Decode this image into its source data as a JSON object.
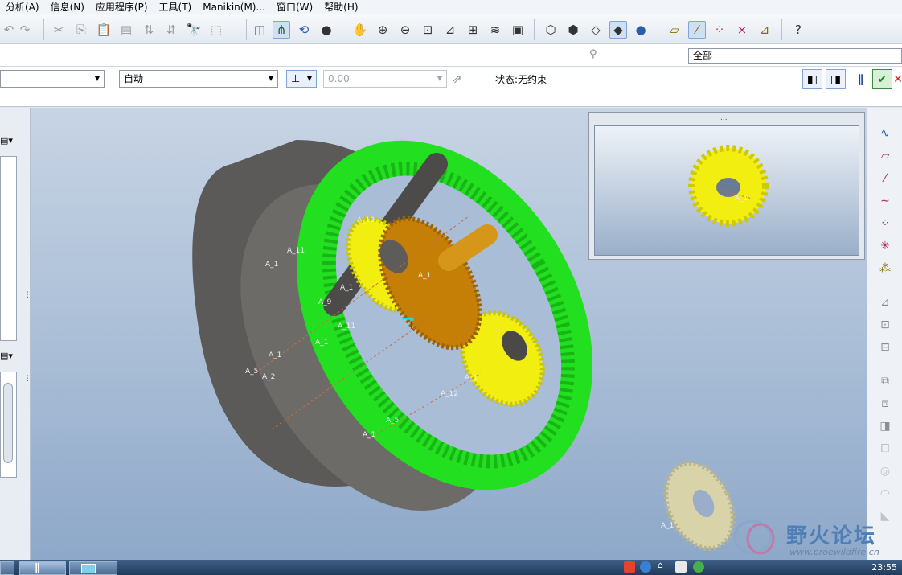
{
  "menu": {
    "items": [
      "分析(A)",
      "信息(N)",
      "应用程序(P)",
      "工具(T)",
      "Manikin(M)...",
      "窗口(W)",
      "帮助(H)"
    ]
  },
  "icons": {
    "undo": "↶",
    "redo": "↷",
    "cut": "✂",
    "copy": "⎘",
    "paste": "📋",
    "binoculars": "🔭",
    "select_box": "⬚",
    "datum_display": "⌂",
    "pan": "✋",
    "zoom_in": "⊕",
    "zoom_out": "⊖",
    "refit": "⊡",
    "spin": "⟲",
    "shade": "●",
    "help": "?"
  },
  "row2": {
    "filter_value": "全部"
  },
  "dashboard": {
    "ref_combo_value": "",
    "mode_combo_value": "自动",
    "value_field": "0.00",
    "status_label": "状态:无约束"
  },
  "viewport": {
    "axis_labels": [
      {
        "id": "a1",
        "text": "A_10"
      },
      {
        "id": "a2",
        "text": "A_1"
      },
      {
        "id": "a3",
        "text": "A_11"
      },
      {
        "id": "a4",
        "text": "A_1"
      },
      {
        "id": "a5",
        "text": "A_9"
      },
      {
        "id": "a6",
        "text": "A_1"
      },
      {
        "id": "a7",
        "text": "A_11"
      },
      {
        "id": "a8",
        "text": "A_1"
      },
      {
        "id": "a9",
        "text": "A_1"
      },
      {
        "id": "a10",
        "text": "A_5"
      },
      {
        "id": "a11",
        "text": "A_2"
      },
      {
        "id": "a12",
        "text": "A_1"
      },
      {
        "id": "a13",
        "text": "A_12"
      },
      {
        "id": "a14",
        "text": "A_5"
      },
      {
        "id": "a15",
        "text": "A_1"
      },
      {
        "id": "a16",
        "text": "A_1"
      }
    ],
    "preview_label": "A_1"
  },
  "watermark": {
    "title": "野火论坛",
    "url": "www.proewildfire.cn"
  },
  "taskbar": {
    "clock": "23:55"
  },
  "colors": {
    "ring_gear": "#22e01f",
    "planet_gear": "#f2ee10",
    "sun_gear": "#c57f07",
    "housing": "#5b5a58",
    "spare_gear": "#d8d3a8"
  }
}
